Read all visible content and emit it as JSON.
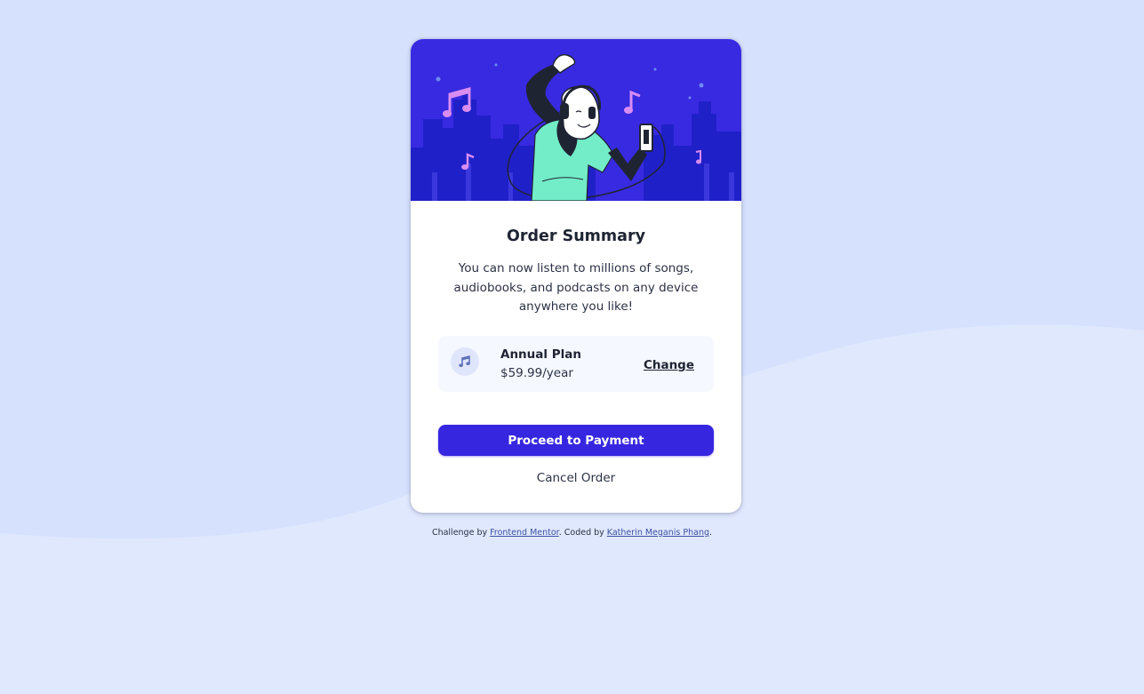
{
  "colors": {
    "page_background": "#e0e8fe",
    "wave": "#d6e1fe",
    "hero_background": "#382ae1",
    "hero_buildings": "#2020c9",
    "primary_button": "#3726e0",
    "plan_background": "#f5f8ff",
    "card_background": "#ffffff",
    "text_dark": "#1f2433",
    "link": "#3e52a3"
  },
  "hero": {
    "illustration": "person-dancing-with-headphones-illustration"
  },
  "card": {
    "title": "Order Summary",
    "description": "You can now listen to millions of songs, audiobooks, and podcasts on any device anywhere you like!"
  },
  "plan": {
    "icon": "music-note-icon",
    "name": "Annual Plan",
    "price": "$59.99/year",
    "change_label": "Change"
  },
  "actions": {
    "proceed_label": "Proceed to Payment",
    "cancel_label": "Cancel Order"
  },
  "attribution": {
    "prefix": "Challenge by ",
    "link1": "Frontend Mentor",
    "middle": ". Coded by ",
    "link2": "Katherin Meganis Phang",
    "suffix": "."
  }
}
